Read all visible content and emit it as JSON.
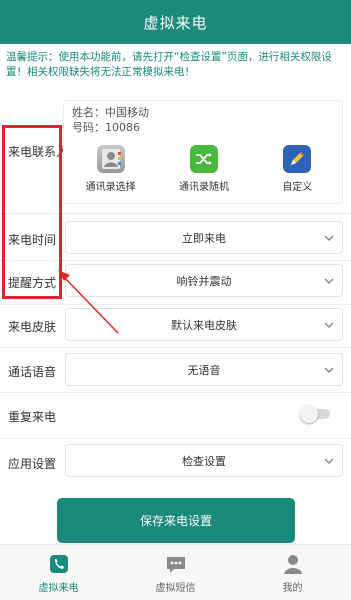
{
  "header": {
    "title": "虚拟来电"
  },
  "warning": {
    "text": "温馨提示：使用本功能前，请先打开“检查设置”页面，进行相关权限设置！相关权限缺失将无法正常模拟来电！"
  },
  "contact": {
    "label": "来电联系人",
    "name": "姓名：中国移动",
    "number": "号码：10086",
    "actions": [
      {
        "label": "通讯录选择",
        "icon": "contacts-book-icon"
      },
      {
        "label": "通讯录随机",
        "icon": "shuffle-icon"
      },
      {
        "label": "自定义",
        "icon": "edit-pen-icon"
      }
    ]
  },
  "settings": {
    "call_time": {
      "label": "来电时间",
      "value": "立即来电"
    },
    "reminder": {
      "label": "提醒方式",
      "value": "响铃并震动"
    },
    "skin": {
      "label": "来电皮肤",
      "value": "默认来电皮肤"
    },
    "voice": {
      "label": "通话语音",
      "value": "无语音"
    },
    "repeat": {
      "label": "重复来电",
      "enabled": false
    },
    "app_settings": {
      "label": "应用设置",
      "value": "检查设置"
    }
  },
  "save_button": {
    "label": "保存来电设置"
  },
  "nav": {
    "items": [
      {
        "label": "虚拟来电",
        "icon": "phone-icon",
        "active": true
      },
      {
        "label": "虚拟短信",
        "icon": "message-icon",
        "active": false
      },
      {
        "label": "我的",
        "icon": "user-icon",
        "active": false
      }
    ]
  },
  "colors": {
    "primary": "#1a8a7a",
    "annotation": "#e0242a",
    "warning_text": "#1a8a7a"
  }
}
